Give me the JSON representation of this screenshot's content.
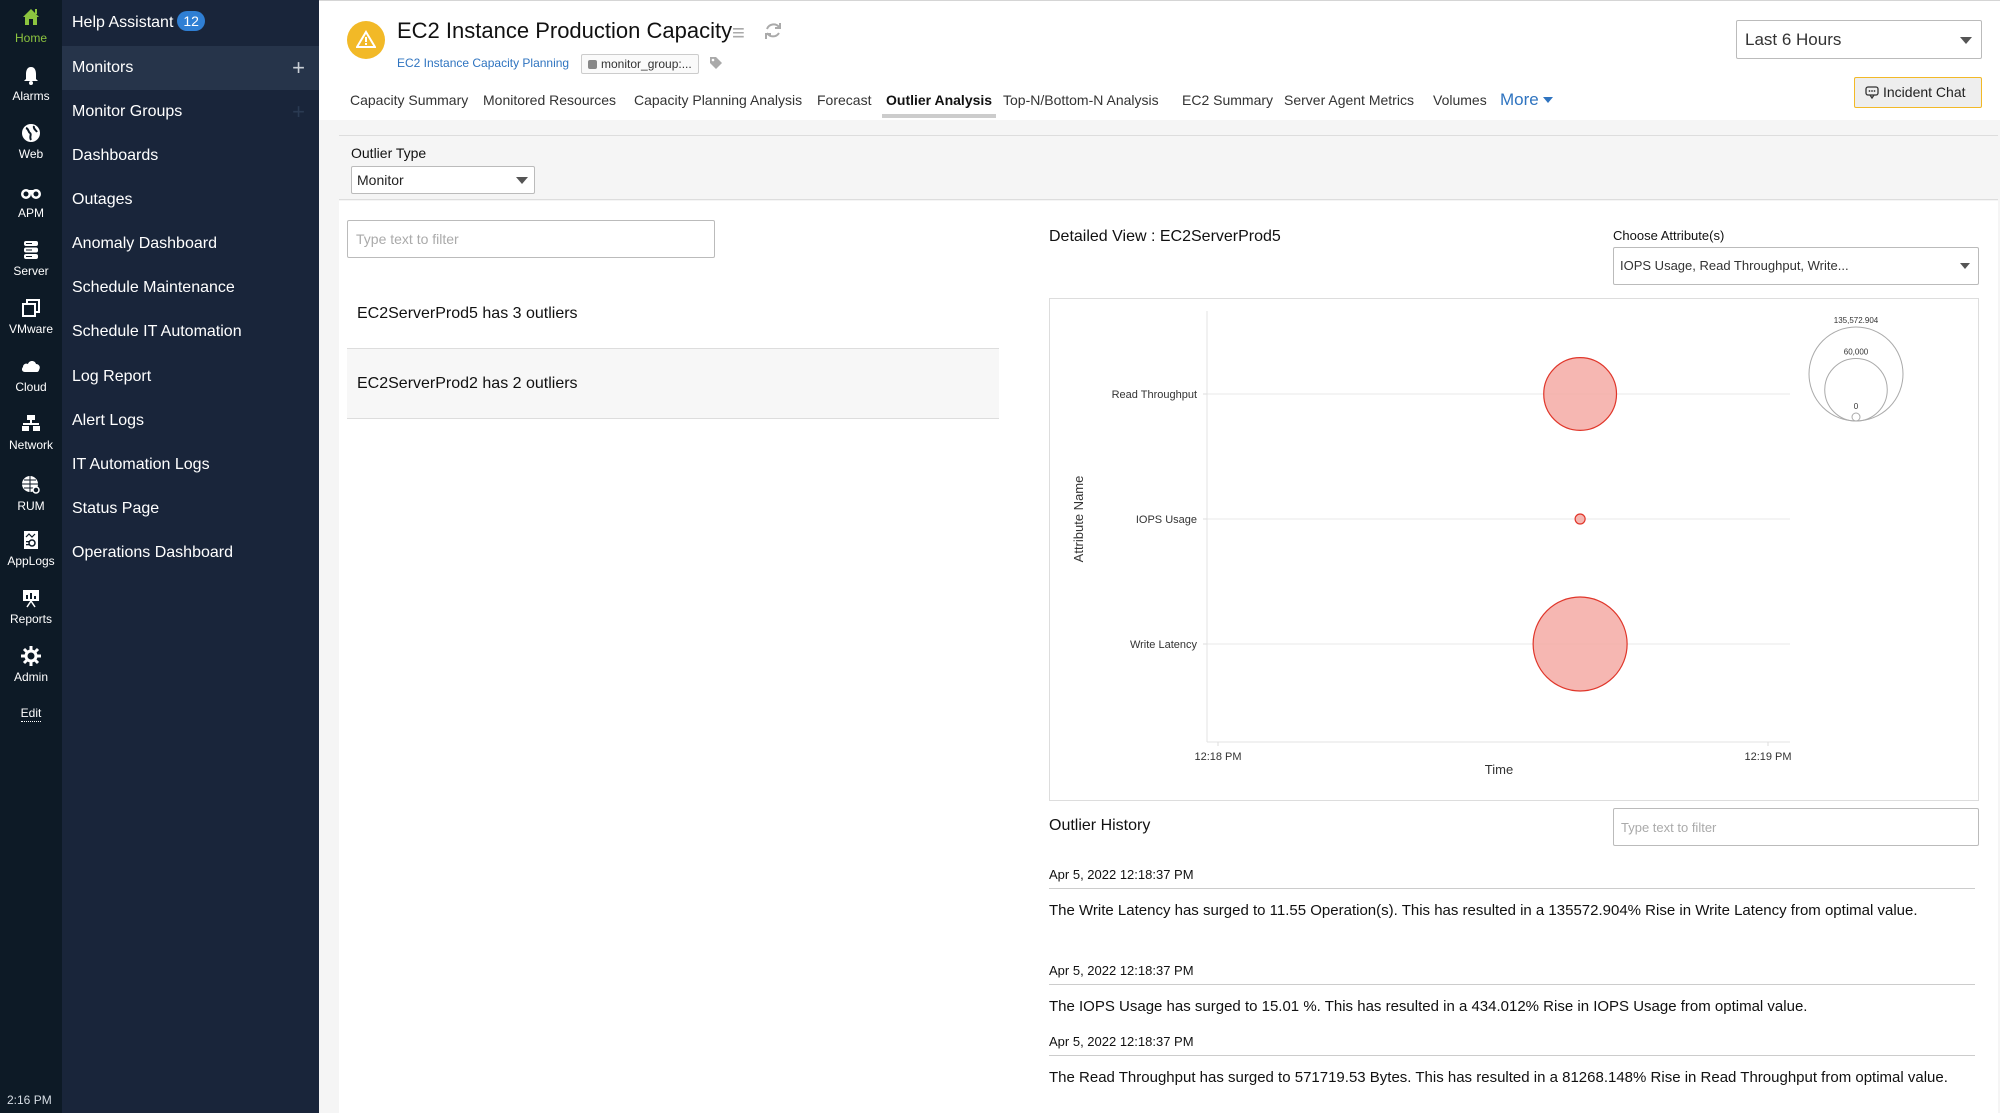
{
  "rail": {
    "items": [
      {
        "label": "Home",
        "icon": "home-icon",
        "active": true
      },
      {
        "label": "Alarms",
        "icon": "bell-icon"
      },
      {
        "label": "Web",
        "icon": "globe-icon"
      },
      {
        "label": "APM",
        "icon": "binoculars-icon"
      },
      {
        "label": "Server",
        "icon": "server-icon"
      },
      {
        "label": "VMware",
        "icon": "vmware-icon"
      },
      {
        "label": "Cloud",
        "icon": "cloud-icon"
      },
      {
        "label": "Network",
        "icon": "network-icon"
      },
      {
        "label": "RUM",
        "icon": "rum-icon"
      },
      {
        "label": "AppLogs",
        "icon": "applogs-icon"
      },
      {
        "label": "Reports",
        "icon": "reports-icon"
      },
      {
        "label": "Admin",
        "icon": "gear-icon"
      }
    ],
    "edit_label": "Edit",
    "time": "2:16 PM",
    "accent": "#8cc43f"
  },
  "nav": {
    "help_label": "Help Assistant",
    "help_count": "12",
    "items": [
      {
        "label": "Monitors",
        "plus": true,
        "active": true
      },
      {
        "label": "Monitor Groups",
        "plus": true
      },
      {
        "label": "Dashboards"
      },
      {
        "label": "Outages"
      },
      {
        "label": "Anomaly Dashboard"
      },
      {
        "label": "Schedule Maintenance"
      },
      {
        "label": "Schedule IT Automation"
      },
      {
        "label": "Log Report"
      },
      {
        "label": "Alert Logs"
      },
      {
        "label": "IT Automation Logs"
      },
      {
        "label": "Status Page"
      },
      {
        "label": "Operations Dashboard"
      }
    ]
  },
  "header": {
    "title": "EC2 Instance Production Capacity",
    "subtitle_link": "EC2 Instance Capacity Planning",
    "tag": "monitor_group:...",
    "status_color": "#f2b927",
    "time_range": "Last 6 Hours",
    "incident_chat": "Incident Chat"
  },
  "tabs": [
    {
      "label": "Capacity Summary"
    },
    {
      "label": "Monitored Resources"
    },
    {
      "label": "Capacity Planning Analysis"
    },
    {
      "label": "Forecast"
    },
    {
      "label": "Outlier Analysis",
      "active": true
    },
    {
      "label": "Top-N/Bottom-N Analysis"
    },
    {
      "label": "EC2 Summary"
    },
    {
      "label": "Server Agent Metrics"
    },
    {
      "label": "Volumes"
    },
    {
      "label": "More"
    }
  ],
  "outlier_type": {
    "label": "Outlier Type",
    "value": "Monitor"
  },
  "monitor_list": {
    "filter_placeholder": "Type text to filter",
    "items": [
      {
        "text": "EC2ServerProd5 has 3 outliers"
      },
      {
        "text": "EC2ServerProd2 has 2 outliers"
      }
    ]
  },
  "detail": {
    "title": "Detailed View : EC2ServerProd5",
    "attr_label": "Choose Attribute(s)",
    "attr_value": "IOPS Usage, Read Throughput, Write..."
  },
  "chart_data": {
    "type": "scatter",
    "subtype": "bubble",
    "xlabel": "Time",
    "ylabel": "Attribute Name",
    "x_ticks": [
      "12:18 PM",
      "12:19 PM"
    ],
    "categories": [
      "Read Throughput",
      "IOPS Usage",
      "Write Latency"
    ],
    "points": [
      {
        "attribute": "Read Throughput",
        "time": "12:18:37 PM",
        "size": 81268.148
      },
      {
        "attribute": "IOPS Usage",
        "time": "12:18:37 PM",
        "size": 434.012
      },
      {
        "attribute": "Write Latency",
        "time": "12:18:37 PM",
        "size": 135572.904
      }
    ],
    "x_fraction": 0.64,
    "size_legend": {
      "max": "135,572.904",
      "mid": "60,000",
      "min": "0",
      "max_value": 135572.904,
      "mid_value": 60000,
      "placement": "top-right"
    },
    "grid": true,
    "bubble_fill": "#f4aaa4",
    "bubble_stroke": "#e0362a"
  },
  "history": {
    "title": "Outlier History",
    "filter_placeholder": "Type text to filter",
    "entries": [
      {
        "date": "Apr 5, 2022 12:18:37 PM",
        "message": "The Write Latency has surged to 11.55 Operation(s). This has resulted in a 135572.904% Rise in Write Latency from optimal value."
      },
      {
        "date": "Apr 5, 2022 12:18:37 PM",
        "message": "The IOPS Usage has surged to 15.01 %. This has resulted in a 434.012% Rise in IOPS Usage from optimal value."
      },
      {
        "date": "Apr 5, 2022 12:18:37 PM",
        "message": "The Read Throughput has surged to 571719.53 Bytes. This has resulted in a 81268.148% Rise in Read Throughput from optimal value."
      }
    ]
  }
}
